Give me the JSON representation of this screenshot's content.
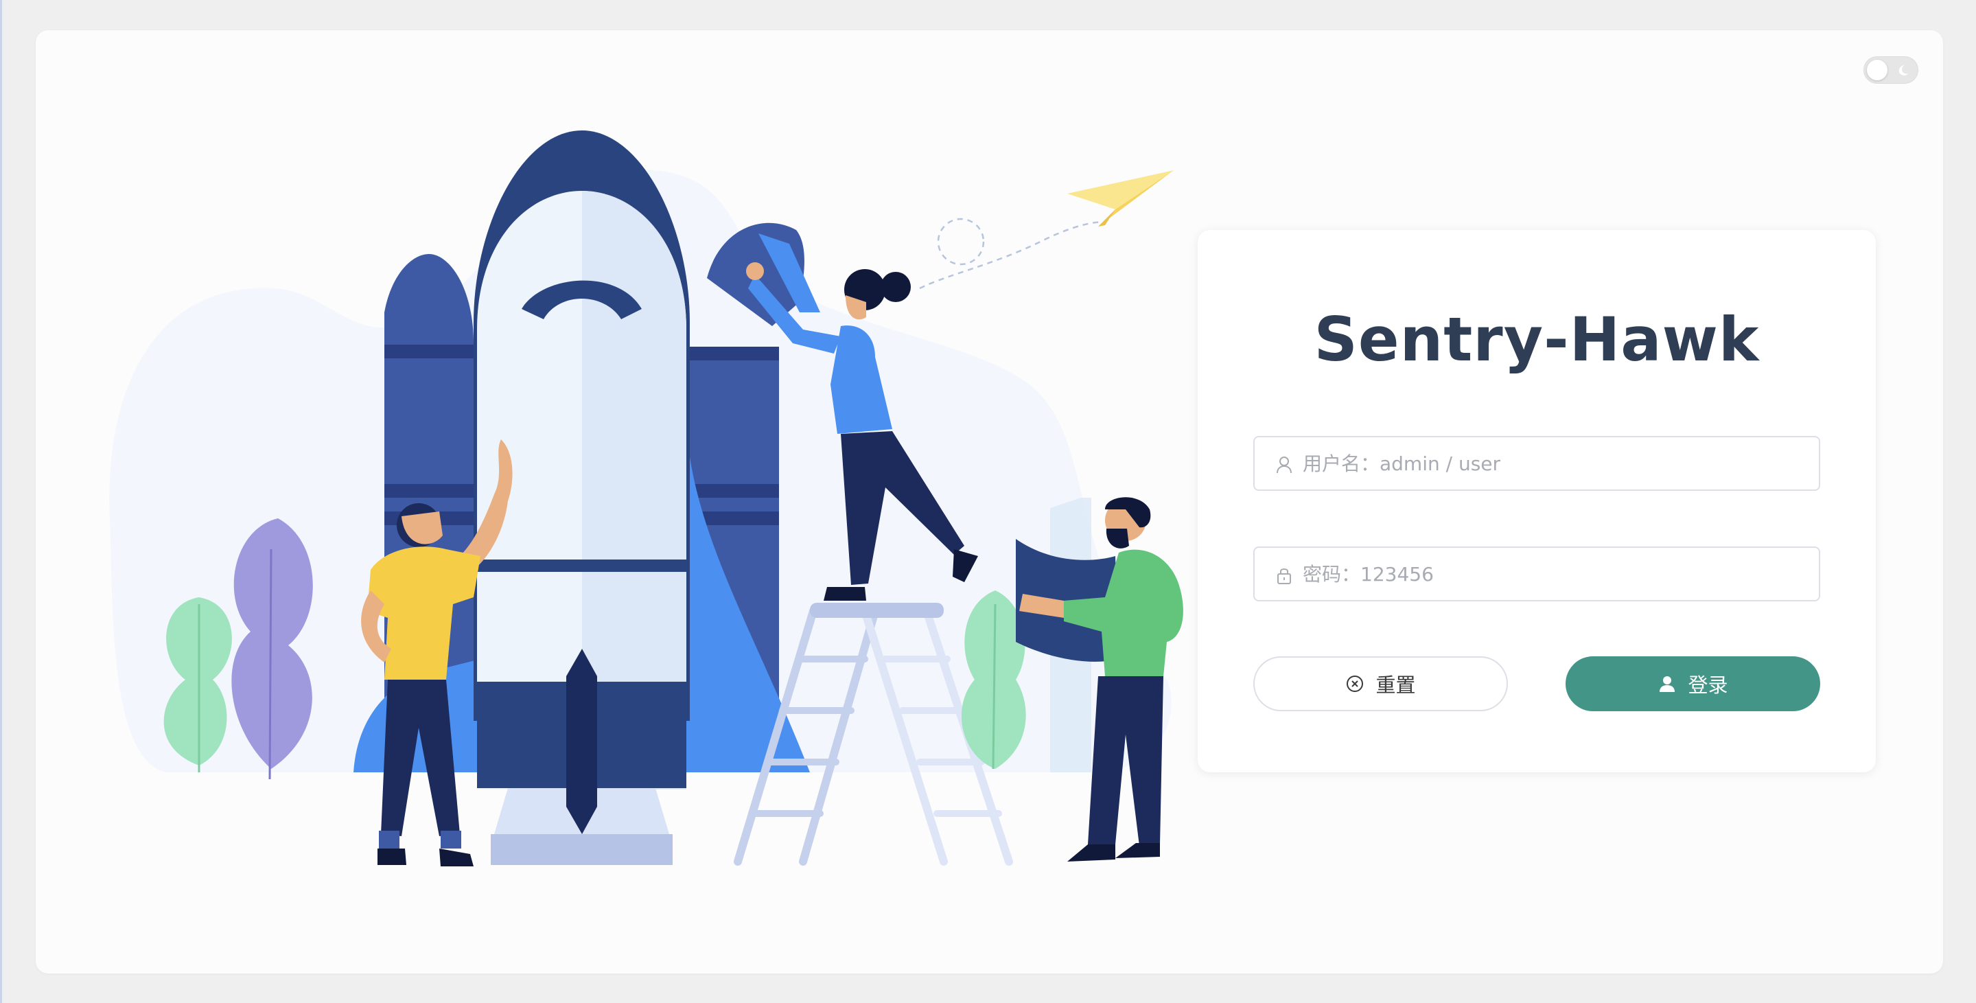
{
  "app": {
    "title": "Sentry-Hawk"
  },
  "theme_toggle": {
    "icon": "moon-icon",
    "state": "light"
  },
  "login": {
    "username_placeholder": "用户名：admin / user",
    "username_value": "",
    "password_placeholder": "密码：123456",
    "password_value": "",
    "reset_label": "重置",
    "login_label": "登录",
    "accent_color": "#439588"
  }
}
